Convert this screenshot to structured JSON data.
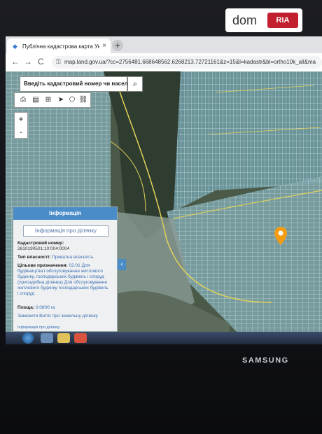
{
  "browser": {
    "tab_title": "Публічна кадастрова карта Укр",
    "tab_close": "×",
    "new_tab": "+",
    "url": "map.land.gov.ua/?cc=2756481,668648562,6268213.72721161&z=15&l=kadastr&bl=ortho10k_all&ma",
    "back": "←",
    "forward": "→",
    "reload": "C"
  },
  "map": {
    "search_placeholder": "Введіть кадастровий номер чи населений",
    "search_icon": "search-icon",
    "zoom_in": "+",
    "zoom_out": "-",
    "tools": [
      "print-icon",
      "layers-icon",
      "measure-icon",
      "pointer-icon",
      "area-icon",
      "link-icon"
    ]
  },
  "info_panel": {
    "header": "Інформація",
    "button": "Інформація про ділянку",
    "cadastral_label": "Кадастровий номер:",
    "cadastral_value": "2610190501:10:004:0004",
    "ownership_label": "Тип власності:",
    "ownership_value": "Приватна власність",
    "purpose_label": "Цільове призначення:",
    "purpose_value": "02.01 Для будівництва і обслуговування житлового будинку, господарських будівель і споруд (присадибна ділянка)",
    "purpose_extra": "Для обслуговування житлового будинку господарських будівель і споруд",
    "area_label": "Площа:",
    "area_value": "0.0800 га",
    "link_label": "Замовити Витяг про земельну ділянку",
    "link2_label": "Інформація про ділянку",
    "collapse": "‹"
  },
  "device": {
    "brand": "SAMSUNG"
  },
  "watermark": {
    "dom": "dom",
    "ria": "RIA"
  },
  "colors": {
    "panel_header": "#4a8cc8",
    "marker": "#f39c12",
    "parcel_outline": "#9fd4e6",
    "roads": "#e2d25a"
  }
}
